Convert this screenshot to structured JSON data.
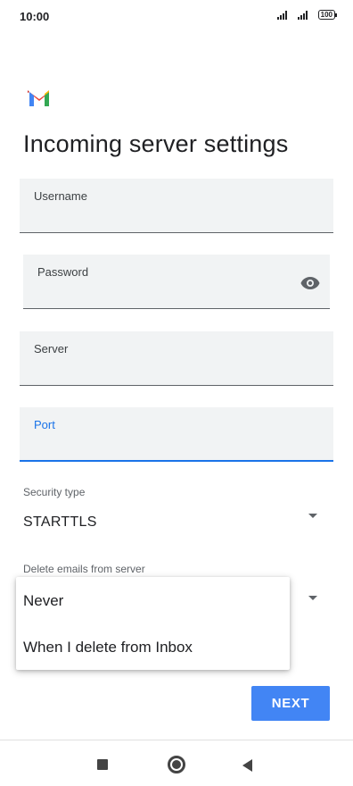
{
  "status_bar": {
    "time": "10:00",
    "signal_icon": "signal-bars-icon",
    "battery_level": "100"
  },
  "logo": {
    "icon": "gmail-logo",
    "colors": [
      "#ea4335",
      "#4285f4",
      "#34a853",
      "#fbbc04"
    ]
  },
  "page": {
    "title": "Incoming server settings"
  },
  "fields": {
    "username": {
      "label": "Username",
      "value": ""
    },
    "password": {
      "label": "Password",
      "value": "",
      "toggle_icon": "eye-icon"
    },
    "server": {
      "label": "Server",
      "value": ""
    },
    "port": {
      "label": "Port",
      "value": ""
    }
  },
  "security_type": {
    "label": "Security type",
    "value": "STARTTLS"
  },
  "delete_emails": {
    "label": "Delete emails from server"
  },
  "dropdown": {
    "options": [
      "Never",
      "When I delete from Inbox"
    ]
  },
  "next_button": {
    "label": "NEXT"
  },
  "colors": {
    "accent": "#1a73e8",
    "button": "#4285f4",
    "field_bg": "#f1f3f4"
  },
  "nav": {
    "recent_icon": "square-icon",
    "home_icon": "circle-icon",
    "back_icon": "triangle-back-icon"
  }
}
